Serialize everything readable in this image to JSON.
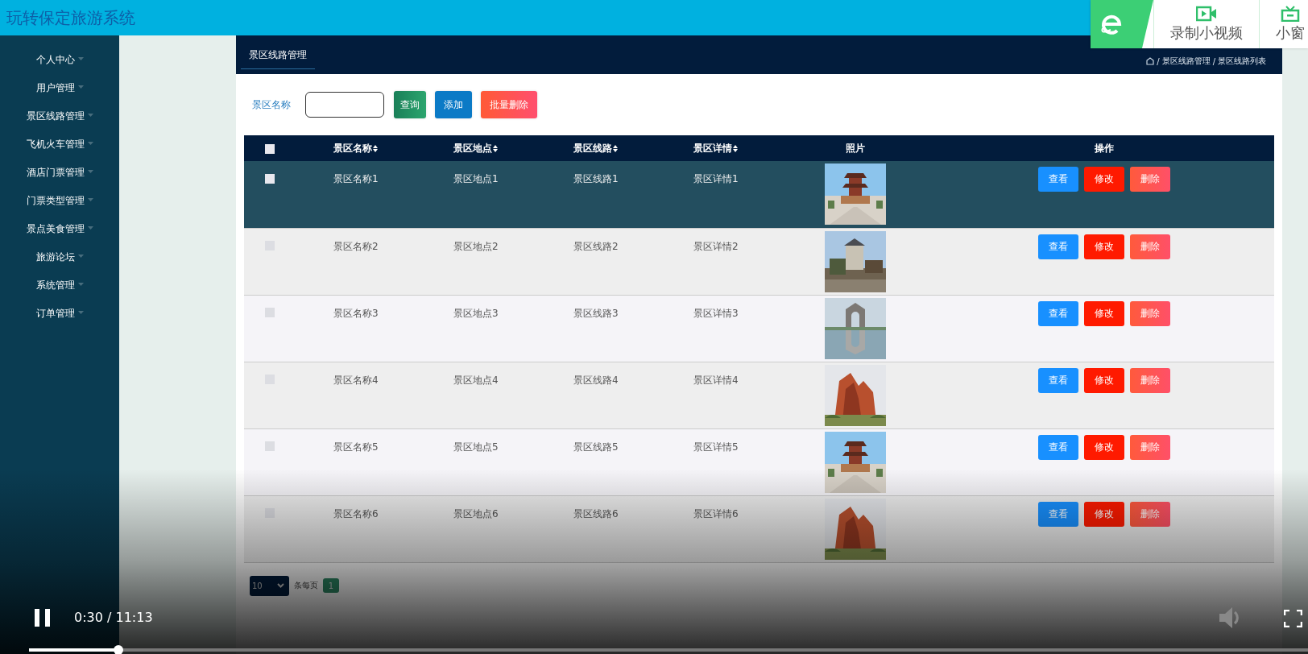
{
  "header": {
    "title": "玩转保定旅游系统"
  },
  "recorder_overlay": {
    "buttons": [
      {
        "label": "录制小视频",
        "kind": "record"
      },
      {
        "label": "小窗",
        "kind": "window"
      }
    ]
  },
  "sidebar": {
    "items": [
      {
        "label": "个人中心"
      },
      {
        "label": "用户管理"
      },
      {
        "label": "景区线路管理"
      },
      {
        "label": "飞机火车管理"
      },
      {
        "label": "酒店门票管理"
      },
      {
        "label": "门票类型管理"
      },
      {
        "label": "景点美食管理"
      },
      {
        "label": "旅游论坛"
      },
      {
        "label": "系统管理"
      },
      {
        "label": "订单管理"
      }
    ]
  },
  "panel": {
    "tab": "景区线路管理",
    "separator": "/",
    "breadcrumb": [
      "景区线路管理",
      "景区线路列表"
    ]
  },
  "search": {
    "label": "景区名称",
    "buttons": [
      {
        "label": "查询",
        "kind": "search"
      },
      {
        "label": "添加",
        "kind": "add"
      },
      {
        "label": "批量删除",
        "kind": "delete"
      }
    ]
  },
  "table": {
    "header_checked": false,
    "columns": [
      {
        "label": "景区名称",
        "sortable": true
      },
      {
        "label": "景区地点",
        "sortable": true
      },
      {
        "label": "景区线路",
        "sortable": true
      },
      {
        "label": "景区详情",
        "sortable": true
      },
      {
        "label": "照片",
        "sortable": false
      },
      {
        "label": "操作",
        "sortable": false
      }
    ],
    "rows": [
      {
        "selected": true,
        "checked": false,
        "name": "景区名称1",
        "place": "景区地点1",
        "route": "景区线路1",
        "detail": "景区详情1",
        "actions": [
          {
            "label": "查看",
            "kind": "view"
          },
          {
            "label": "修改",
            "kind": "edit"
          },
          {
            "label": "删除",
            "kind": "delete"
          }
        ]
      },
      {
        "selected": false,
        "checked": false,
        "name": "景区名称2",
        "place": "景区地点2",
        "route": "景区线路2",
        "detail": "景区详情2",
        "actions": [
          {
            "label": "查看",
            "kind": "view"
          },
          {
            "label": "修改",
            "kind": "edit"
          },
          {
            "label": "删除",
            "kind": "delete"
          }
        ]
      },
      {
        "selected": false,
        "checked": false,
        "name": "景区名称3",
        "place": "景区地点3",
        "route": "景区线路3",
        "detail": "景区详情3",
        "actions": [
          {
            "label": "查看",
            "kind": "view"
          },
          {
            "label": "修改",
            "kind": "edit"
          },
          {
            "label": "删除",
            "kind": "delete"
          }
        ]
      },
      {
        "selected": false,
        "checked": false,
        "name": "景区名称4",
        "place": "景区地点4",
        "route": "景区线路4",
        "detail": "景区详情4",
        "actions": [
          {
            "label": "查看",
            "kind": "view"
          },
          {
            "label": "修改",
            "kind": "edit"
          },
          {
            "label": "删除",
            "kind": "delete"
          }
        ]
      },
      {
        "selected": false,
        "checked": false,
        "name": "景区名称5",
        "place": "景区地点5",
        "route": "景区线路5",
        "detail": "景区详情5",
        "actions": [
          {
            "label": "查看",
            "kind": "view"
          },
          {
            "label": "修改",
            "kind": "edit"
          },
          {
            "label": "删除",
            "kind": "delete"
          }
        ]
      },
      {
        "selected": false,
        "checked": false,
        "name": "景区名称6",
        "place": "景区地点6",
        "route": "景区线路6",
        "detail": "景区详情6",
        "actions": [
          {
            "label": "查看",
            "kind": "view"
          },
          {
            "label": "修改",
            "kind": "edit"
          },
          {
            "label": "删除",
            "kind": "delete"
          }
        ]
      }
    ]
  },
  "pagination": {
    "page_size": "10",
    "page_size_label": "条每页",
    "pages": [
      {
        "label": "1",
        "selected": true
      }
    ]
  },
  "player": {
    "playing": true,
    "time": "0:30 / 11:13",
    "level": 0.07
  }
}
